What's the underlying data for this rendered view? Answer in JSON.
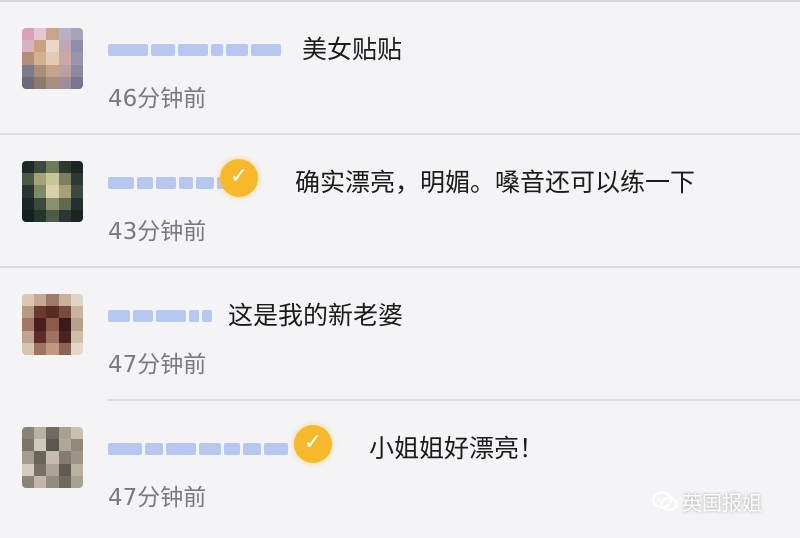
{
  "comments": [
    {
      "text": "美女贴贴",
      "time": "46分钟前",
      "verified": false,
      "avatar_colors": [
        "#d9a0b8",
        "#e8c7d4",
        "#c9a58f",
        "#b8b0c4",
        "#a8a3b8",
        "#d6b3c0",
        "#caa07f",
        "#e9d7c9",
        "#bfa8b6",
        "#8f8ea8",
        "#b58c7a",
        "#d2b18f",
        "#e3c9b8",
        "#caa9a5",
        "#9a95aa",
        "#7e7a8c",
        "#a98f7a",
        "#c8a38a",
        "#b9a0a1",
        "#8d8aa0",
        "#6f6a7a",
        "#8c7a6c",
        "#a58f80",
        "#9c8f98",
        "#7a7590"
      ]
    },
    {
      "text": "确实漂亮，明媚。嗓音还可以练一下",
      "time": "43分钟前",
      "verified": true,
      "avatar_colors": [
        "#1e2a2a",
        "#3a4a3c",
        "#6b7a5a",
        "#2c3a30",
        "#1a2524",
        "#4a5a44",
        "#a3a27a",
        "#c9c49a",
        "#7d8060",
        "#2d3a33",
        "#2a3430",
        "#7c8a68",
        "#d8d0a8",
        "#a5a07a",
        "#3b4a3c",
        "#1c2624",
        "#394a3a",
        "#8a906c",
        "#5d6a50",
        "#223030",
        "#16201f",
        "#263430",
        "#4d5c46",
        "#2a3632",
        "#1a2422"
      ]
    },
    {
      "text": "这是我的新老婆",
      "time": "47分钟前",
      "verified": false,
      "avatar_colors": [
        "#d8c8b4",
        "#c8a890",
        "#a07a64",
        "#c8b09a",
        "#e0d4c4",
        "#b89a84",
        "#6a3a30",
        "#5a2a26",
        "#7a4a3c",
        "#c8b4a0",
        "#a07868",
        "#4a1e1c",
        "#8a5a4c",
        "#3c1a18",
        "#b8a08c",
        "#c0a490",
        "#5c2c28",
        "#a07060",
        "#4a2220",
        "#d0bca8",
        "#d8c4b0",
        "#9c7460",
        "#c09884",
        "#8a6454",
        "#e4d8c8"
      ]
    },
    {
      "text": "小姐姐好漂亮！",
      "time": "47分钟前",
      "verified": true,
      "avatar_colors": [
        "#8a8276",
        "#b8b0a4",
        "#6e6a60",
        "#a8a090",
        "#c8c0b4",
        "#7c7468",
        "#d0c8bc",
        "#5a5650",
        "#b0a898",
        "#908878",
        "#a49c8e",
        "#6a6458",
        "#c4bcae",
        "#847c70",
        "#9c9484",
        "#d4ccc0",
        "#787064",
        "#aca494",
        "#605a50",
        "#b8b0a0",
        "#8c8476",
        "#c0b8aa",
        "#948c7e",
        "#706a5e",
        "#a8a092"
      ]
    }
  ],
  "watermark": {
    "text": "英国报姐",
    "icon": "wechat-icon"
  }
}
